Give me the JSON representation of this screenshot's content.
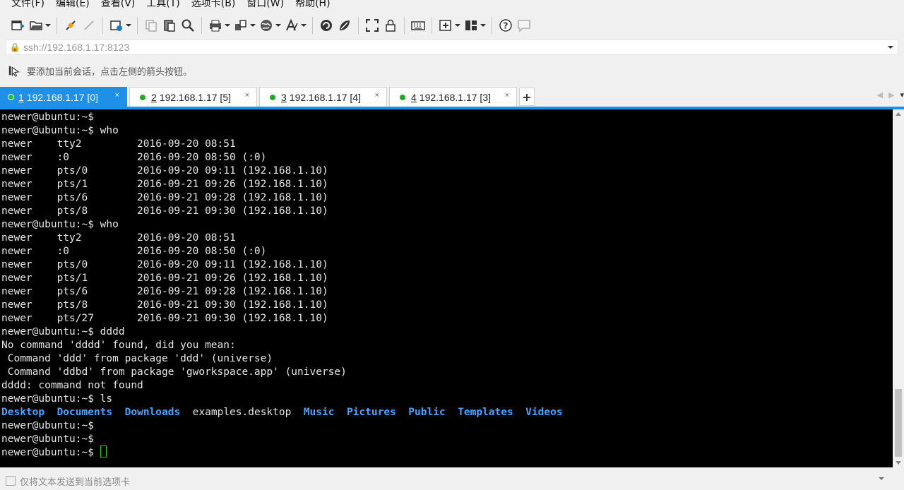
{
  "menu": [
    "文件(F)",
    "编辑(E)",
    "查看(V)",
    "工具(T)",
    "选项卡(B)",
    "窗口(W)",
    "帮助(H)"
  ],
  "address": {
    "lock_icon": "lock-icon",
    "url": "ssh://192.168.1.17:8123"
  },
  "hint": {
    "text": "要添加当前会话，点击左侧的箭头按钮。"
  },
  "tabs": [
    {
      "num": "1",
      "label": "192.168.1.17 [0]",
      "active": true
    },
    {
      "num": "2",
      "label": "192.168.1.17 [5]",
      "active": false
    },
    {
      "num": "3",
      "label": "192.168.1.17 [4]",
      "active": false
    },
    {
      "num": "4",
      "label": "192.168.1.17 [3]",
      "active": false
    }
  ],
  "tab_close": "×",
  "tab_add": "+",
  "terminal": {
    "lines": [
      "newer@ubuntu:~$",
      "newer@ubuntu:~$ who",
      "newer    tty2         2016-09-20 08:51",
      "newer    :0           2016-09-20 08:50 (:0)",
      "newer    pts/0        2016-09-20 09:11 (192.168.1.10)",
      "newer    pts/1        2016-09-21 09:26 (192.168.1.10)",
      "newer    pts/6        2016-09-21 09:28 (192.168.1.10)",
      "newer    pts/8        2016-09-21 09:30 (192.168.1.10)",
      "newer@ubuntu:~$ who",
      "newer    tty2         2016-09-20 08:51",
      "newer    :0           2016-09-20 08:50 (:0)",
      "newer    pts/0        2016-09-20 09:11 (192.168.1.10)",
      "newer    pts/1        2016-09-21 09:26 (192.168.1.10)",
      "newer    pts/6        2016-09-21 09:28 (192.168.1.10)",
      "newer    pts/8        2016-09-21 09:30 (192.168.1.10)",
      "newer    pts/27       2016-09-21 09:30 (192.168.1.10)",
      "newer@ubuntu:~$ dddd",
      "No command 'dddd' found, did you mean:",
      " Command 'ddd' from package 'ddd' (universe)",
      " Command 'ddbd' from package 'gworkspace.app' (universe)",
      "dddd: command not found",
      "newer@ubuntu:~$ ls"
    ],
    "ls_output": [
      {
        "name": "Desktop",
        "type": "dir"
      },
      {
        "name": "Documents",
        "type": "dir"
      },
      {
        "name": "Downloads",
        "type": "dir"
      },
      {
        "name": "examples.desktop",
        "type": "file"
      },
      {
        "name": "Music",
        "type": "dir"
      },
      {
        "name": "Pictures",
        "type": "dir"
      },
      {
        "name": "Public",
        "type": "dir"
      },
      {
        "name": "Templates",
        "type": "dir"
      },
      {
        "name": "Videos",
        "type": "dir"
      }
    ],
    "trailing_lines": [
      "newer@ubuntu:~$",
      "newer@ubuntu:~$"
    ],
    "prompt": "newer@ubuntu:~$ ",
    "colors": {
      "background": "#000000",
      "text": "#e6e6e6",
      "dir": "#4aa3ff",
      "cursor": "#1ecc1e"
    }
  },
  "sendbar": {
    "text": "仅将文本发送到当前选项卡"
  },
  "accent": "#1e90e8"
}
